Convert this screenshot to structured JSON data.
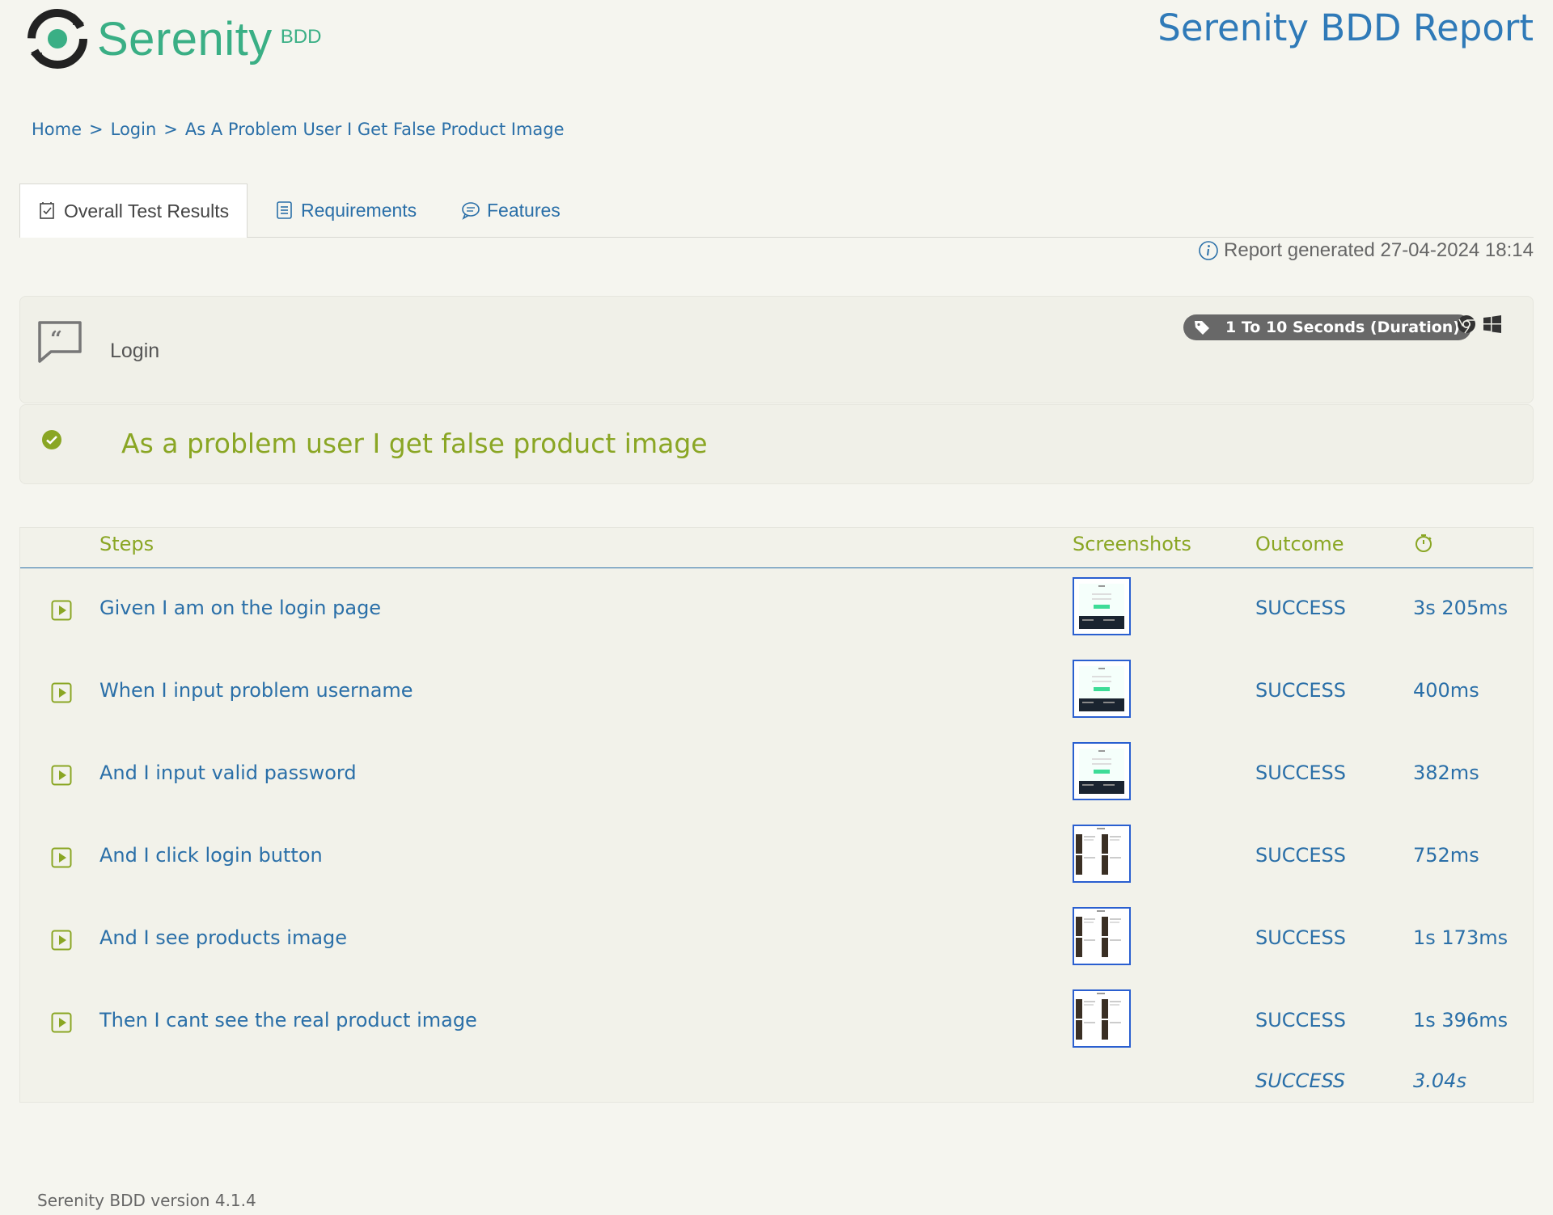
{
  "header": {
    "logo_word": "Serenity",
    "logo_suffix": "BDD",
    "report_title": "Serenity BDD Report"
  },
  "breadcrumb": [
    "Home",
    "Login",
    "As A Problem User I Get False Product Image"
  ],
  "tabs": [
    {
      "label": "Overall Test Results",
      "icon": "checklist-icon",
      "active": true
    },
    {
      "label": "Requirements",
      "icon": "requirements-icon",
      "active": false
    },
    {
      "label": "Features",
      "icon": "chat-icon",
      "active": false
    }
  ],
  "report_generated": "Report generated 27-04-2024 18:14",
  "feature": {
    "name": "Login",
    "icon": "quote-bubble-icon",
    "tag": "1 To 10 Seconds (Duration)",
    "platform_icons": [
      "chrome-icon",
      "windows-icon"
    ]
  },
  "scenario": {
    "title": "As a problem user I get false product image",
    "status_icon": "check-circle-icon",
    "status_color": "#8aa624"
  },
  "table": {
    "headers": {
      "steps": "Steps",
      "screenshots": "Screenshots",
      "outcome": "Outcome",
      "duration_icon": "stopwatch-icon"
    },
    "rows": [
      {
        "step": "Given I am on the login page",
        "screenshot": "login-page",
        "outcome": "SUCCESS",
        "duration": "3s 205ms"
      },
      {
        "step": "When I input problem username",
        "screenshot": "login-page",
        "outcome": "SUCCESS",
        "duration": "400ms"
      },
      {
        "step": "And I input valid password",
        "screenshot": "login-page",
        "outcome": "SUCCESS",
        "duration": "382ms"
      },
      {
        "step": "And I click login button",
        "screenshot": "products-page",
        "outcome": "SUCCESS",
        "duration": "752ms"
      },
      {
        "step": "And I see products image",
        "screenshot": "products-page",
        "outcome": "SUCCESS",
        "duration": "1s 173ms"
      },
      {
        "step": "Then I cant see the real product image",
        "screenshot": "products-page",
        "outcome": "SUCCESS",
        "duration": "1s 396ms"
      }
    ],
    "total": {
      "outcome": "SUCCESS",
      "duration": "3.04s"
    }
  },
  "footer": "Serenity BDD version 4.1.4",
  "colors": {
    "brand_green": "#3aaf85",
    "link_blue": "#2a6fa8",
    "success_green": "#8aa624",
    "background": "#f5f5ef"
  }
}
